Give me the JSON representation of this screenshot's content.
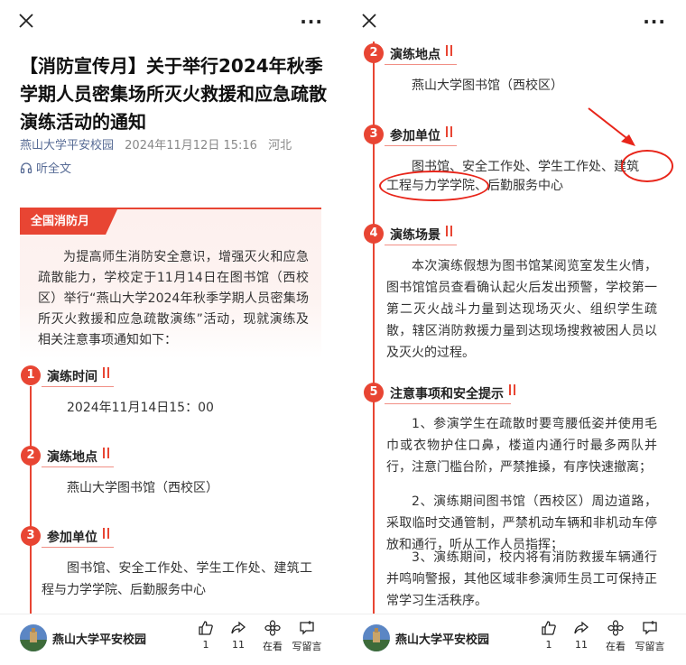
{
  "left": {
    "article": {
      "title": "【消防宣传月】关于举行2024年秋季学期人员密集场所灭火救援和应急疏散演练活动的通知",
      "account": "燕山大学平安校园",
      "datetime": "2024年11月12日 15:16",
      "location": "河北",
      "listen_label": "听全文",
      "badge": "全国消防月",
      "intro": "为提高师生消防安全意识，增强灭火和应急疏散能力，学校定于11月14日在图书馆（西校区）举行“燕山大学2024年秋季学期人员密集场所灭火救援和应急疏散演练”活动，现就演练及相关注意事项通知如下："
    },
    "sections": [
      {
        "num": "1",
        "title": "演练时间",
        "body": "2024年11月14日15：00"
      },
      {
        "num": "2",
        "title": "演练地点",
        "body": "燕山大学图书馆（西校区）"
      },
      {
        "num": "3",
        "title": "参加单位",
        "body": "图书馆、安全工作处、学生工作处、建筑工程与力学学院、后勤服务中心"
      }
    ]
  },
  "right": {
    "sections": [
      {
        "num": "2",
        "title": "演练地点",
        "body": "燕山大学图书馆（西校区）"
      },
      {
        "num": "3",
        "title": "参加单位",
        "body_line1": "图书馆、安全工作处、学生工作处、建筑",
        "body_line2": "工程与力学学院、后勤服务中心"
      },
      {
        "num": "4",
        "title": "演练场景",
        "body": "本次演练假想为图书馆某阅览室发生火情，图书馆馆员查看确认起火后发出预警，学校第一第二灭火战斗力量到达现场灭火、组织学生疏散，辖区消防救援力量到达现场搜救被困人员以及灭火的过程。"
      },
      {
        "num": "5",
        "title": "注意事项和安全提示",
        "p1": "1、参演学生在疏散时要弯腰低姿并使用毛巾或衣物护住口鼻，楼道内通行时最多两队并行，注意门槛台阶，严禁推搡，有序快速撤离；",
        "p2": "2、演练期间图书馆（西校区）周边道路，采取临时交通管制，严禁机动车辆和非机动车停放和通行，听从工作人员指挥；",
        "p3": "3、演练期间，校内将有消防救援车辆通行并鸣响警报，其他区域非参演师生员工可保持正常学习生活秩序。"
      }
    ]
  },
  "bottom_bar": {
    "account": "燕山大学平安校园",
    "like_count": "1",
    "share_count": "11",
    "zaikan_label": "在看",
    "comment_label": "写留言"
  },
  "colors": {
    "accent": "#e84533",
    "link": "#576b95",
    "annotation": "#e8251a"
  }
}
